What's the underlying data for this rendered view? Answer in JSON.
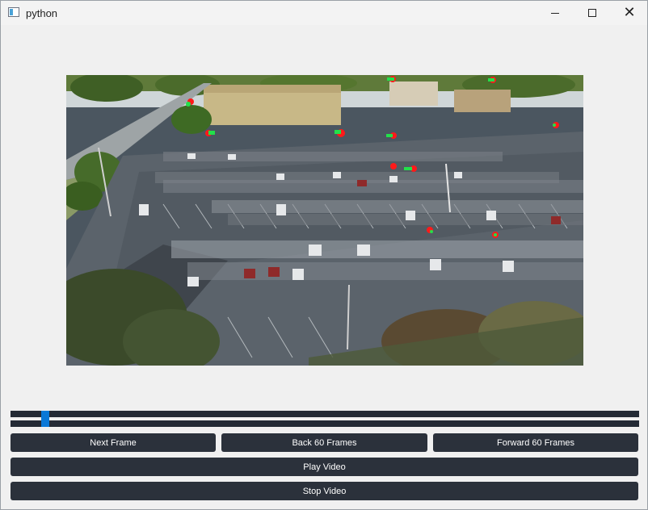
{
  "window": {
    "title": "python",
    "icon": "app-window-icon",
    "controls": {
      "minimize_icon": "minimize-icon",
      "maximize_icon": "maximize-icon",
      "close_icon": "close-icon"
    }
  },
  "video": {
    "description_icon": "parking-lot-video-frame"
  },
  "slider": {
    "position_fraction": 0.05,
    "accent": "#0a78d7"
  },
  "buttons": {
    "next_frame": "Next Frame",
    "back_60": "Back 60 Frames",
    "forward_60": "Forward 60 Frames",
    "play": "Play Video",
    "stop": "Stop Video"
  },
  "colors": {
    "button_bg": "#2b313b",
    "marker_red": "#ff1a1a",
    "marker_green": "#22e04a"
  }
}
